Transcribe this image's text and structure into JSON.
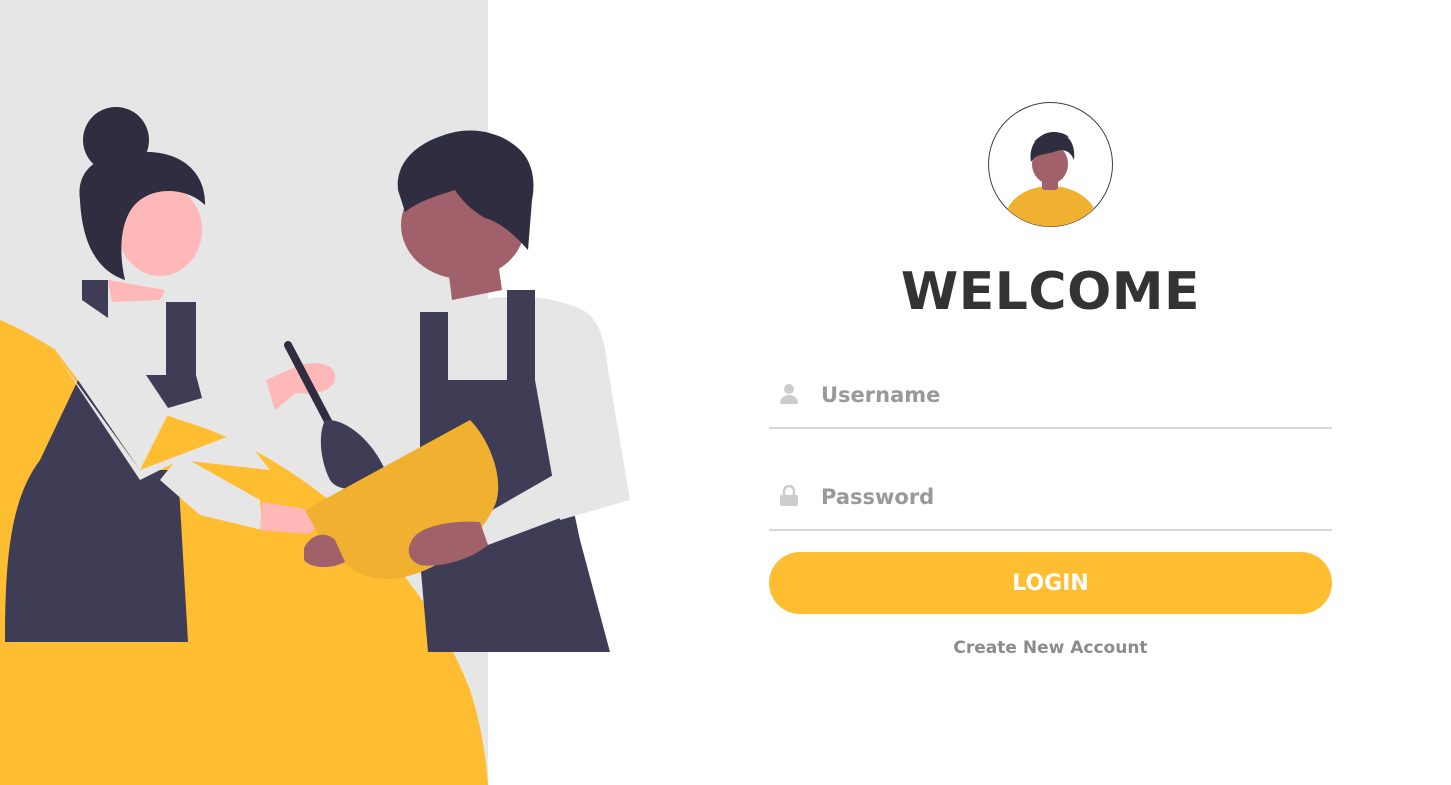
{
  "login": {
    "title": "WELCOME",
    "username_placeholder": "Username",
    "password_placeholder": "Password",
    "login_label": "LOGIN",
    "create_account_label": "Create New Account"
  },
  "illustration": {
    "subject": "two-people-cooking",
    "icons": {
      "username": "user-icon",
      "password": "lock-icon"
    }
  },
  "colors": {
    "accent": "#ffbd31",
    "panel_bg": "#e6e6e6",
    "text_dark": "#333333",
    "text_muted": "#999999",
    "apron": "#3f3d56",
    "hair": "#2f2e41",
    "skin_light": "#ffb8b8",
    "skin_dark": "#a0616a",
    "bowl": "#f0b030"
  }
}
